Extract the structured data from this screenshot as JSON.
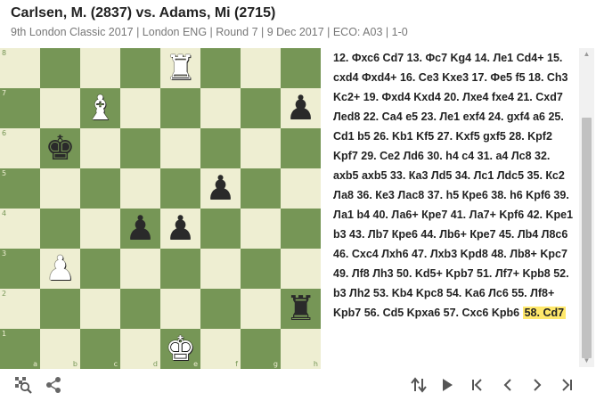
{
  "header": {
    "title": "Carlsen, M. (2837) vs. Adams, Mi (2715)",
    "subtitle": "9th London Classic 2017 | London ENG | Round 7 | 9 Dec 2017 | ECO: A03 | 1-0"
  },
  "board": {
    "ranks": [
      "8",
      "7",
      "6",
      "5",
      "4",
      "3",
      "2",
      "1"
    ],
    "files": [
      "a",
      "b",
      "c",
      "d",
      "e",
      "f",
      "g",
      "h"
    ],
    "colors": {
      "light": "#eeeed2",
      "dark": "#769656"
    },
    "pieces": [
      {
        "square": "e8",
        "type": "rook",
        "color": "white",
        "glyph": "♜"
      },
      {
        "square": "c7",
        "type": "bishop",
        "color": "white",
        "glyph": "♝"
      },
      {
        "square": "h7",
        "type": "pawn",
        "color": "black",
        "glyph": "♟"
      },
      {
        "square": "b6",
        "type": "king",
        "color": "black",
        "glyph": "♚"
      },
      {
        "square": "f5",
        "type": "pawn",
        "color": "black",
        "glyph": "♟"
      },
      {
        "square": "d4",
        "type": "pawn",
        "color": "black",
        "glyph": "♟"
      },
      {
        "square": "e4",
        "type": "pawn",
        "color": "black",
        "glyph": "♟"
      },
      {
        "square": "b3",
        "type": "pawn",
        "color": "white",
        "glyph": "♟"
      },
      {
        "square": "h2",
        "type": "rook",
        "color": "black",
        "glyph": "♜"
      },
      {
        "square": "e1",
        "type": "king",
        "color": "white",
        "glyph": "♚"
      }
    ]
  },
  "moves": {
    "text": "12. Фхс6 Cd7 13. Фс7 Kg4 14. Ле1 Cd4+ 15. cxd4 Фхd4+ 16. Се3 Kxe3 17. Фе5 f5 18. Ch3 Kc2+ 19. Фхd4 Kxd4 20. Лхе4 fxe4 21. Cxd7 Лed8 22. Са4 e5 23. Ле1 exf4 24. gxf4 a6 25. Cd1 b5 26. Kb1 Kf5 27. Kxf5 gxf5 28. Kpf2 Kpf7 29. Се2 Лd6 30. h4 c4 31. a4 Лс8 32. axb5 axb5 33. Ка3 Лd5 34. Лс1 Лdc5 35. Кс2 Ла8 36. Ке3 Лас8 37. h5 Кре6 38. h6 Kpf6 39. Ла1 b4 40. Ла6+ Кре7 41. Ла7+ Kpf6 42. Kpe1 b3 43. Лb7 Кре6 44. Лb6+ Кре7 45. Лb4 Л8с6 46. Cxc4 Лxh6 47. Лxb3 Kpd8 48. Лb8+ Kpc7 49. Лf8 Лh3 50. Kd5+ Kpb7 51. Лf7+ Kpb8 52. b3 Лh2 53. Kb4 Kpc8 54. Ka6 Лс6 55. Лf8+ Kpb7 56. Cd5 Kpxa6 57. Cxc6 Kpb6",
    "current": "58. Cd7"
  },
  "toolbar": {
    "left": [
      "search-board-icon",
      "share-icon"
    ],
    "right": [
      "flip-board-icon",
      "play-icon",
      "first-move-icon",
      "previous-move-icon",
      "next-move-icon",
      "last-move-icon"
    ]
  }
}
